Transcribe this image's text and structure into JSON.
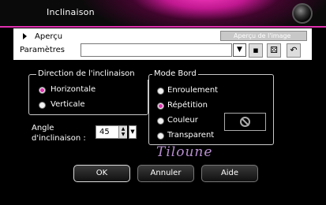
{
  "window": {
    "title": "Inclinaison"
  },
  "preview": {
    "toggle_label": "Aperçu"
  },
  "presets": {
    "label": "Paramètres",
    "value": "",
    "top_field_text": "Aperçu de l'image",
    "dropdown_icon": "double-chevron-down-icon",
    "tool_icons": [
      "save-icon",
      "dice-icon",
      "reset-icon"
    ]
  },
  "direction": {
    "title": "Direction de l'inclinaison",
    "options": [
      {
        "label": "Horizontale",
        "selected": true
      },
      {
        "label": "Verticale",
        "selected": false
      }
    ]
  },
  "angle": {
    "label_line1": "Angle",
    "label_line2": "d'inclinaison :",
    "value": "45"
  },
  "edge_mode": {
    "title": "Mode Bord",
    "options": [
      {
        "label": "Enroulement",
        "selected": false
      },
      {
        "label": "Répétition",
        "selected": true
      },
      {
        "label": "Couleur",
        "selected": false
      },
      {
        "label": "Transparent",
        "selected": false
      }
    ],
    "color_swatch_icon": "no-color-icon"
  },
  "signature": "Tiloune",
  "buttons": {
    "ok": "OK",
    "cancel": "Annuler",
    "help": "Aide"
  },
  "colors": {
    "accent": "#e030b0",
    "background": "#000000"
  }
}
